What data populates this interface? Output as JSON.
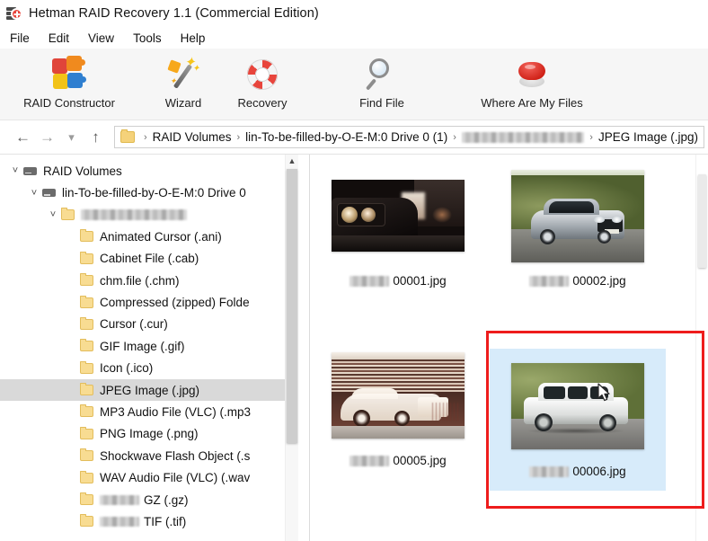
{
  "window": {
    "title": "Hetman RAID Recovery 1.1 (Commercial Edition)",
    "app_icon": "raid-disk-icon"
  },
  "menu": {
    "items": [
      {
        "label": "File"
      },
      {
        "label": "Edit"
      },
      {
        "label": "View"
      },
      {
        "label": "Tools"
      },
      {
        "label": "Help"
      }
    ]
  },
  "toolbar": {
    "buttons": [
      {
        "label": "RAID Constructor",
        "icon": "puzzle-pieces-icon"
      },
      {
        "label": "Wizard",
        "icon": "magic-wand-icon"
      },
      {
        "label": "Recovery",
        "icon": "life-ring-icon"
      },
      {
        "label": "Find File",
        "icon": "magnifier-icon"
      },
      {
        "label": "Where Are My Files",
        "icon": "red-push-button-icon"
      }
    ]
  },
  "addressbar": {
    "back_icon": "arrow-left-icon",
    "forward_icon": "arrow-right-icon",
    "history_icon": "chevron-down-icon",
    "up_icon": "arrow-up-icon",
    "folder_icon": "folder-icon",
    "separator": "›",
    "crumbs": [
      {
        "label": "RAID Volumes",
        "redacted": false
      },
      {
        "label": "lin-To-be-filled-by-O-E-M:0 Drive 0 (1)",
        "redacted": false
      },
      {
        "label": "",
        "redacted": true,
        "blur_width": 150
      },
      {
        "label": "JPEG Image (.jpg)",
        "redacted": false
      }
    ]
  },
  "tree": {
    "scroll_up_icon": "chevron-up-icon",
    "items": [
      {
        "label": "RAID Volumes",
        "icon": "drive-icon",
        "indent": 0,
        "chevron": "˅",
        "selected": false,
        "redacted": false
      },
      {
        "label": "lin-To-be-filled-by-O-E-M:0 Drive 0",
        "icon": "drive-icon",
        "indent": 1,
        "chevron": "˅",
        "selected": false,
        "redacted": false
      },
      {
        "label": "",
        "icon": "folder-icon",
        "indent": 2,
        "chevron": "˅",
        "selected": false,
        "redacted": true,
        "blur_width": 118
      },
      {
        "label": "Animated Cursor (.ani)",
        "icon": "folder-icon",
        "indent": 3,
        "chevron": "",
        "selected": false,
        "redacted": false
      },
      {
        "label": "Cabinet File (.cab)",
        "icon": "folder-icon",
        "indent": 3,
        "chevron": "",
        "selected": false,
        "redacted": false
      },
      {
        "label": "chm.file (.chm)",
        "icon": "folder-icon",
        "indent": 3,
        "chevron": "",
        "selected": false,
        "redacted": false
      },
      {
        "label": "Compressed (zipped) Folde",
        "icon": "folder-icon",
        "indent": 3,
        "chevron": "",
        "selected": false,
        "redacted": false
      },
      {
        "label": "Cursor (.cur)",
        "icon": "folder-icon",
        "indent": 3,
        "chevron": "",
        "selected": false,
        "redacted": false
      },
      {
        "label": "GIF Image (.gif)",
        "icon": "folder-icon",
        "indent": 3,
        "chevron": "",
        "selected": false,
        "redacted": false
      },
      {
        "label": "Icon (.ico)",
        "icon": "folder-icon",
        "indent": 3,
        "chevron": "",
        "selected": false,
        "redacted": false
      },
      {
        "label": "JPEG Image (.jpg)",
        "icon": "folder-icon",
        "indent": 3,
        "chevron": "",
        "selected": true,
        "redacted": false
      },
      {
        "label": "MP3 Audio File (VLC) (.mp3",
        "icon": "folder-icon",
        "indent": 3,
        "chevron": "",
        "selected": false,
        "redacted": false
      },
      {
        "label": "PNG Image (.png)",
        "icon": "folder-icon",
        "indent": 3,
        "chevron": "",
        "selected": false,
        "redacted": false
      },
      {
        "label": "Shockwave Flash Object (.s",
        "icon": "folder-icon",
        "indent": 3,
        "chevron": "",
        "selected": false,
        "redacted": false
      },
      {
        "label": "WAV Audio File (VLC) (.wav",
        "icon": "folder-icon",
        "indent": 3,
        "chevron": "",
        "selected": false,
        "redacted": false
      },
      {
        "label": "GZ (.gz)",
        "icon": "folder-icon",
        "indent": 3,
        "chevron": "",
        "selected": false,
        "redacted": false,
        "prefix_redacted": true,
        "prefix_width": 44
      },
      {
        "label": "TIF (.tif)",
        "icon": "folder-icon",
        "indent": 3,
        "chevron": "",
        "selected": false,
        "redacted": false,
        "prefix_redacted": true,
        "prefix_width": 44
      }
    ]
  },
  "files": {
    "items": [
      {
        "name": "00001.jpg",
        "name_redacted": true,
        "prefix_width": 44,
        "art": "t1",
        "selected": false
      },
      {
        "name": "00002.jpg",
        "name_redacted": true,
        "prefix_width": 44,
        "art": "t2",
        "selected": false
      },
      {
        "name": "00005.jpg",
        "name_redacted": true,
        "prefix_width": 44,
        "art": "t3",
        "selected": false
      },
      {
        "name": "00006.jpg",
        "name_redacted": true,
        "prefix_width": 44,
        "art": "t4",
        "selected": true
      }
    ],
    "cursor_icon": "mouse-pointer-icon",
    "annotation_color": "#ee1c1c",
    "selection_color": "#d7ebfa"
  }
}
